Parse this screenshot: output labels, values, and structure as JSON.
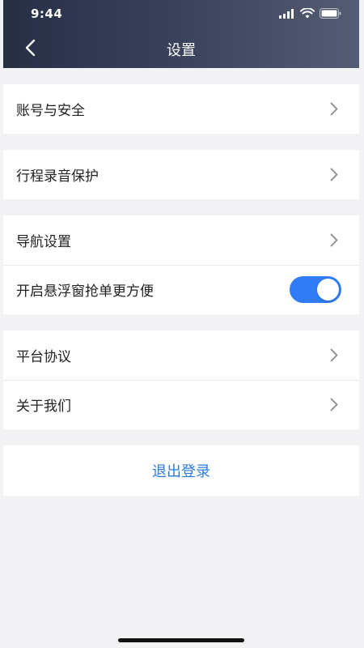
{
  "status_bar": {
    "time": "9:44"
  },
  "nav": {
    "title": "设置"
  },
  "groups": [
    {
      "items": [
        {
          "label": "账号与安全",
          "type": "link"
        }
      ]
    },
    {
      "items": [
        {
          "label": "行程录音保护",
          "type": "link"
        }
      ]
    },
    {
      "items": [
        {
          "label": "导航设置",
          "type": "link"
        },
        {
          "label": "开启悬浮窗抢单更方便",
          "type": "toggle",
          "on": true
        }
      ]
    },
    {
      "items": [
        {
          "label": "平台协议",
          "type": "link"
        },
        {
          "label": "关于我们",
          "type": "link"
        }
      ]
    }
  ],
  "logout": {
    "label": "退出登录"
  },
  "icons": {
    "back": "chevron-left-icon",
    "row_arrow": "chevron-right-icon",
    "signal": "cellular-signal-icon",
    "wifi": "wifi-icon",
    "battery": "battery-icon"
  },
  "colors": {
    "accent": "#2f7cf6",
    "logout_text": "#2a7ae0",
    "header_start": "#272f45",
    "header_end": "#555d74"
  }
}
